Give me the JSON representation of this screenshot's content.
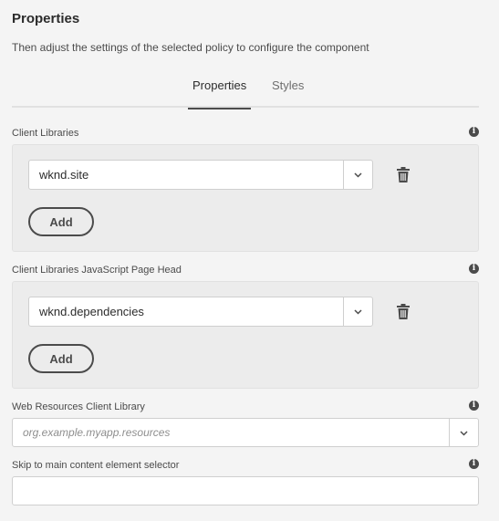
{
  "header": {
    "title": "Properties",
    "description": "Then adjust the settings of the selected policy to configure the component"
  },
  "tabs": [
    {
      "label": "Properties",
      "active": true
    },
    {
      "label": "Styles",
      "active": false
    }
  ],
  "client_libraries": {
    "label": "Client Libraries",
    "value": "wknd.site",
    "add_label": "Add"
  },
  "client_libraries_js_head": {
    "label": "Client Libraries JavaScript Page Head",
    "value": "wknd.dependencies",
    "add_label": "Add"
  },
  "web_resources": {
    "label": "Web Resources Client Library",
    "placeholder": "org.example.myapp.resources"
  },
  "skip_to_main": {
    "label": "Skip to main content element selector",
    "value": ""
  },
  "icons": {
    "info": "info-icon",
    "trash": "trash-icon",
    "chevron": "chevron-down-icon"
  },
  "colors": {
    "background": "#f4f4f4",
    "panel": "#ececec",
    "text": "#2c2c2c",
    "muted": "#6e6e6e"
  }
}
